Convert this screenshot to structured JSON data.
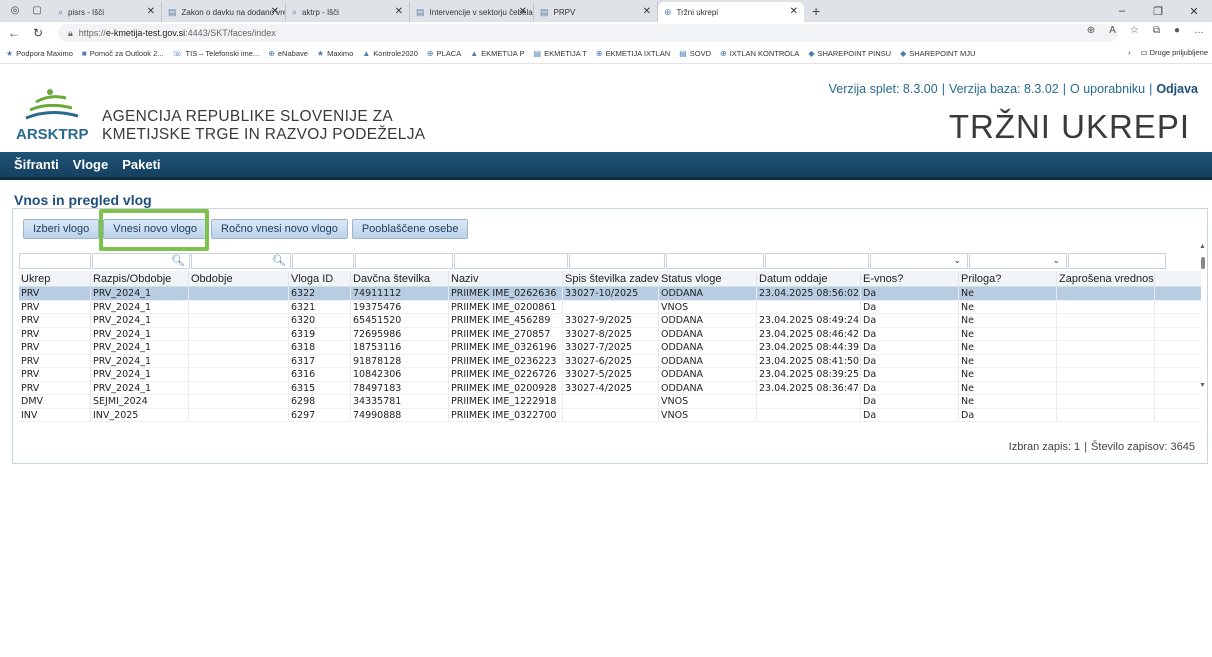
{
  "browser": {
    "tabs": [
      {
        "title": "pisrs - Išči",
        "favicon": "search-icon"
      },
      {
        "title": "Zakon o davku na dodano vredno",
        "favicon": "doc-icon"
      },
      {
        "title": "aktrp - Išči",
        "favicon": "search-icon"
      },
      {
        "title": "Intervencije v sektorju čebelarski",
        "favicon": "doc-icon"
      },
      {
        "title": "PRPV",
        "favicon": "doc-icon"
      },
      {
        "title": "Tržni ukrepi",
        "favicon": "globe-icon",
        "active": true
      }
    ],
    "url_prefix": "https://",
    "url_host": "e-kmetija-test.gov.si",
    "url_rest": ":4443/SKT/faces/index",
    "favorites": [
      "Podpora Maximo",
      "Pomoč za Outlook 2...",
      "TIS – Telefonski ime...",
      "eNabave",
      "Maximo",
      "Kontrole2020",
      "PLACA",
      "EKMETIJA P",
      "EKMETIJA T",
      "EKMETIJA IXTLAN",
      "SOVD",
      "IXTLAN KONTROLA",
      "SHAREPOINT PINSU",
      "SHAREPOINT MJU"
    ],
    "favorites_other": "Druge priljubljene"
  },
  "header": {
    "agency_line1": "AGENCIJA REPUBLIKE SLOVENIJE ZA",
    "agency_line2": "KMETIJSKE TRGE IN RAZVOJ PODEŽELJA",
    "logo_text": "ARSKTRP",
    "version_web": "Verzija splet: 8.3.00",
    "version_db": "Verzija baza: 8.3.02",
    "about_user": "O uporabniku",
    "logout": "Odjava",
    "app_title": "TRŽNI UKREPI"
  },
  "menu": [
    "Šifranti",
    "Vloge",
    "Paketi"
  ],
  "page": {
    "title": "Vnos in pregled vlog",
    "buttons": [
      "Izberi vlogo",
      "Vnesi novo vlogo",
      "Ročno vnesi novo vlogo",
      "Pooblaščene osebe"
    ]
  },
  "table": {
    "columns": [
      "Ukrep",
      "Razpis/Obdobje",
      "Obdobje",
      "Vloga ID",
      "Davčna številka",
      "Naziv",
      "Spis številka zadeve",
      "Status vloge",
      "Datum oddaje",
      "E-vnos?",
      "Priloga?",
      "Zaprošena vrednost"
    ],
    "rows": [
      [
        "PRV",
        "PRV_2024_1",
        "",
        "6322",
        "74911112",
        "PRIIMEK IME_0262636",
        "33027-10/2025",
        "ODDANA",
        "23.04.2025 08:56:02",
        "Da",
        "Ne",
        ""
      ],
      [
        "PRV",
        "PRV_2024_1",
        "",
        "6321",
        "19375476",
        "PRIIMEK IME_0200861",
        "",
        "VNOS",
        "",
        "Da",
        "Ne",
        ""
      ],
      [
        "PRV",
        "PRV_2024_1",
        "",
        "6320",
        "65451520",
        "PRIIMEK IME_456289",
        "33027-9/2025",
        "ODDANA",
        "23.04.2025 08:49:24",
        "Da",
        "Ne",
        ""
      ],
      [
        "PRV",
        "PRV_2024_1",
        "",
        "6319",
        "72695986",
        "PRIIMEK IME_270857",
        "33027-8/2025",
        "ODDANA",
        "23.04.2025 08:46:42",
        "Da",
        "Ne",
        ""
      ],
      [
        "PRV",
        "PRV_2024_1",
        "",
        "6318",
        "18753116",
        "PRIIMEK IME_0326196",
        "33027-7/2025",
        "ODDANA",
        "23.04.2025 08:44:39",
        "Da",
        "Ne",
        ""
      ],
      [
        "PRV",
        "PRV_2024_1",
        "",
        "6317",
        "91878128",
        "PRIIMEK IME_0236223",
        "33027-6/2025",
        "ODDANA",
        "23.04.2025 08:41:50",
        "Da",
        "Ne",
        ""
      ],
      [
        "PRV",
        "PRV_2024_1",
        "",
        "6316",
        "10842306",
        "PRIIMEK IME_0226726",
        "33027-5/2025",
        "ODDANA",
        "23.04.2025 08:39:25",
        "Da",
        "Ne",
        ""
      ],
      [
        "PRV",
        "PRV_2024_1",
        "",
        "6315",
        "78497183",
        "PRIIMEK IME_0200928",
        "33027-4/2025",
        "ODDANA",
        "23.04.2025 08:36:47",
        "Da",
        "Ne",
        ""
      ],
      [
        "DMV",
        "SEJMI_2024",
        "",
        "6298",
        "34335781",
        "PRIIMEK IME_1222918",
        "",
        "VNOS",
        "",
        "Da",
        "Ne",
        ""
      ],
      [
        "INV",
        "INV_2025",
        "",
        "6297",
        "74990888",
        "PRIIMEK IME_0322700",
        "",
        "VNOS",
        "",
        "Da",
        "Da",
        ""
      ]
    ],
    "selected_row": 0
  },
  "status": {
    "selected": "Izbran zapis: 1",
    "count": "Število zapisov: 3645"
  },
  "colors": {
    "menu_bar": "#1f5379",
    "brand_blue": "#2a6a8f",
    "highlight_green": "#7ec24d",
    "selected_row": "#b9cde2"
  }
}
